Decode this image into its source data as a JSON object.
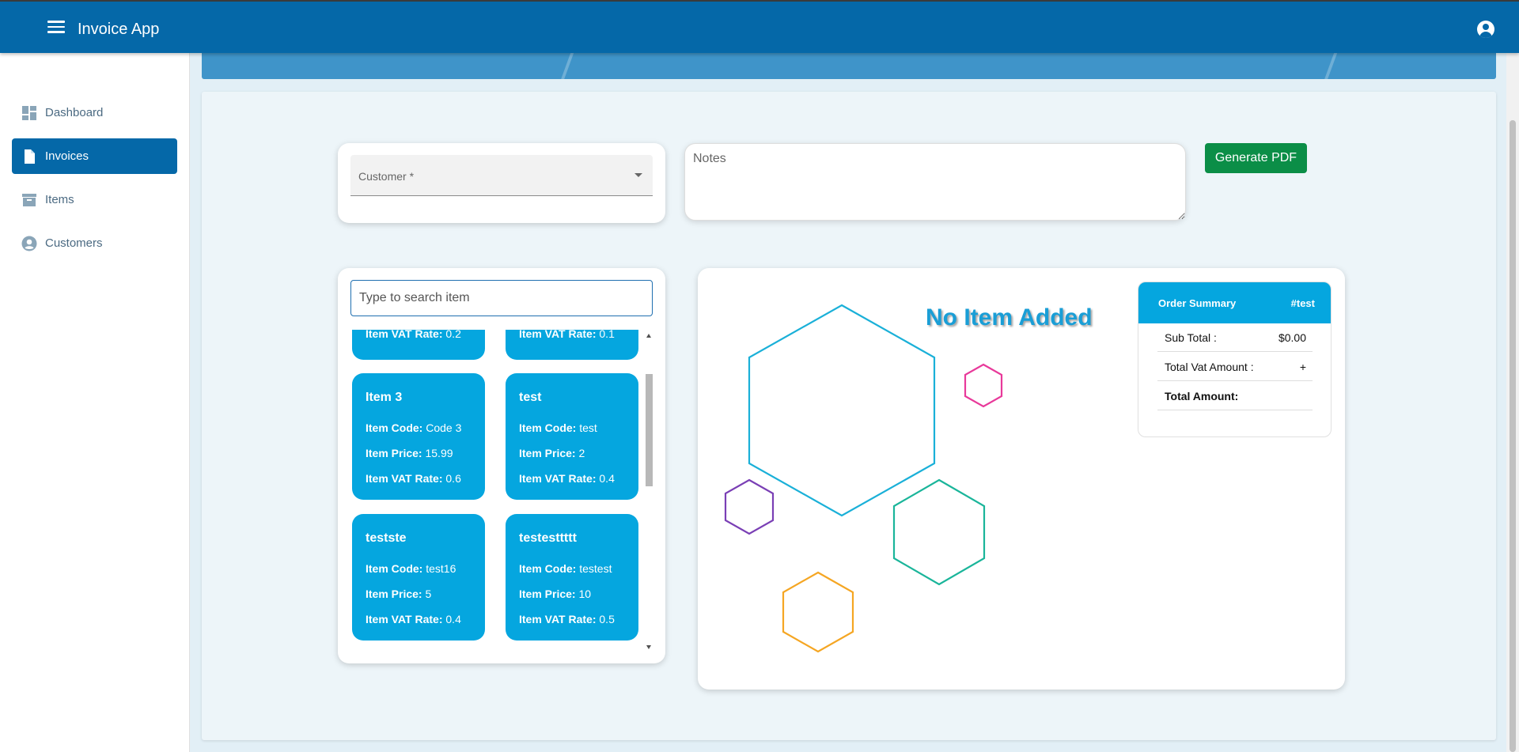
{
  "app": {
    "title": "Invoice App"
  },
  "sidebar": {
    "items": [
      {
        "label": "Dashboard",
        "icon": "dashboard-icon",
        "active": false
      },
      {
        "label": "Invoices",
        "icon": "document-icon",
        "active": true
      },
      {
        "label": "Items",
        "icon": "archive-icon",
        "active": false
      },
      {
        "label": "Customers",
        "icon": "account-circle-icon",
        "active": false
      }
    ]
  },
  "form": {
    "customer_label": "Customer *",
    "notes_placeholder": "Notes",
    "generate_pdf_label": "Generate PDF"
  },
  "items_panel": {
    "search_placeholder": "Type to search item",
    "field_labels": {
      "code": "Item Code:",
      "price": "Item Price:",
      "vat": "Item VAT Rate:"
    },
    "partial_items": [
      {
        "vat": "0.2"
      },
      {
        "vat": "0.1"
      }
    ],
    "items": [
      {
        "name": "Item 3",
        "code": "Code 3",
        "price": "15.99",
        "vat": "0.6"
      },
      {
        "name": "test",
        "code": "test",
        "price": "2",
        "vat": "0.4"
      },
      {
        "name": "testste",
        "code": "test16",
        "price": "5",
        "vat": "0.4"
      },
      {
        "name": "testesttttt",
        "code": "testest",
        "price": "10",
        "vat": "0.5"
      }
    ]
  },
  "empty_state": {
    "message": "No Item Added"
  },
  "order_summary": {
    "title": "Order Summary",
    "ref": "#test",
    "rows": [
      {
        "label": "Sub Total :",
        "value": "$0.00"
      },
      {
        "label": "Total Vat Amount :",
        "value": "+"
      },
      {
        "label": "Total Amount:",
        "value": ""
      }
    ]
  },
  "colors": {
    "appbar": "#0568a8",
    "accent": "#05a6df",
    "success": "#0b8e47",
    "hex_blue": "#1ab0d8",
    "hex_pink": "#e8399a",
    "hex_purple": "#7a3fb5",
    "hex_teal": "#1ab59a",
    "hex_orange": "#f5a623"
  }
}
